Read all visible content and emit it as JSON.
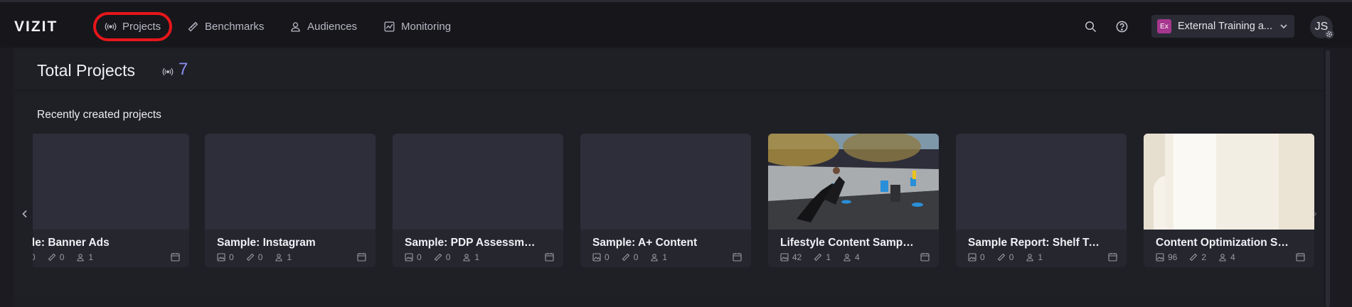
{
  "brand": {
    "logo": "VIZIT"
  },
  "nav": [
    {
      "label": "Projects",
      "icon": "broadcast-icon"
    },
    {
      "label": "Benchmarks",
      "icon": "ruler-icon"
    },
    {
      "label": "Audiences",
      "icon": "user-icon"
    },
    {
      "label": "Monitoring",
      "icon": "chart-line-icon"
    }
  ],
  "header": {
    "org_badge": "Ex",
    "org_name": "External Training a...",
    "user_initials": "JS"
  },
  "summary": {
    "title": "Total Projects",
    "count": "7"
  },
  "recent": {
    "title": "Recently created projects",
    "cards": [
      {
        "title": "nple: Banner Ads",
        "images": "0",
        "benchmarks": "0",
        "audiences": "1",
        "thumb": "blank"
      },
      {
        "title": "Sample: Instagram",
        "images": "0",
        "benchmarks": "0",
        "audiences": "1",
        "thumb": "blank"
      },
      {
        "title": "Sample: PDP Assessment",
        "images": "0",
        "benchmarks": "0",
        "audiences": "1",
        "thumb": "blank"
      },
      {
        "title": "Sample: A+ Content",
        "images": "0",
        "benchmarks": "0",
        "audiences": "1",
        "thumb": "blank"
      },
      {
        "title": "Lifestyle Content Sample ...",
        "images": "42",
        "benchmarks": "1",
        "audiences": "4",
        "thumb": "athlete-photo"
      },
      {
        "title": "Sample Report: Shelf Tests",
        "images": "0",
        "benchmarks": "0",
        "audiences": "1",
        "thumb": "blank"
      },
      {
        "title": "Content Optimization Sam...",
        "images": "96",
        "benchmarks": "2",
        "audiences": "4",
        "thumb": "bottle-photo"
      }
    ]
  },
  "colors": {
    "accent": "#8c8ff2",
    "highlight": "#e6161a",
    "org_badge": "#a7378e"
  }
}
